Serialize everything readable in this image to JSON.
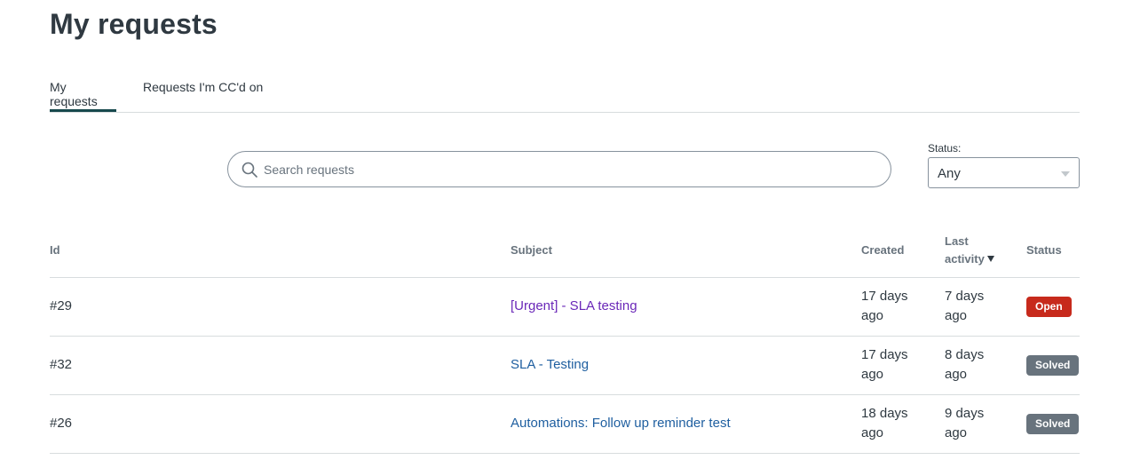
{
  "page": {
    "title": "My requests"
  },
  "tabs": [
    {
      "label": "My requests",
      "active": true
    },
    {
      "label": "Requests I'm CC'd on",
      "active": false
    }
  ],
  "search": {
    "placeholder": "Search requests",
    "value": ""
  },
  "status_filter": {
    "label": "Status:",
    "selected": "Any"
  },
  "table": {
    "headers": {
      "id": "Id",
      "subject": "Subject",
      "created": "Created",
      "last_activity": "Last activity",
      "status": "Status"
    },
    "rows": [
      {
        "id": "#29",
        "subject": "[Urgent] - SLA testing",
        "created": "17 days ago",
        "last_activity": "7 days ago",
        "status": "Open"
      },
      {
        "id": "#32",
        "subject": "SLA - Testing",
        "created": "17 days ago",
        "last_activity": "8 days ago",
        "status": "Solved"
      },
      {
        "id": "#26",
        "subject": "Automations: Follow up reminder test",
        "created": "18 days ago",
        "last_activity": "9 days ago",
        "status": "Solved"
      }
    ]
  },
  "colors": {
    "open_badge": "#c72a1c",
    "solved_badge": "#68737d",
    "active_tab_underline": "#17494d",
    "link": "#1f5fa0",
    "visited_link": "#6a27b8"
  },
  "icons": {
    "search": "search-icon",
    "dropdown": "chevron-down-icon",
    "sort": "sort-descending-icon"
  }
}
